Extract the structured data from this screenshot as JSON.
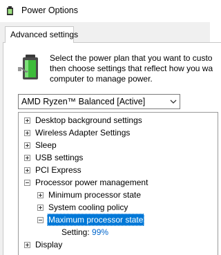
{
  "window": {
    "title": "Power Options"
  },
  "tabs": [
    {
      "label": "Advanced settings"
    }
  ],
  "intro": {
    "lines": [
      "Select the power plan that you want to custo",
      "then choose settings that reflect how you wa",
      "computer to manage power."
    ]
  },
  "plan_select": {
    "selected": "AMD Ryzen™ Balanced [Active]"
  },
  "tree": {
    "items": [
      {
        "label": "Desktop background settings",
        "state": "collapsed"
      },
      {
        "label": "Wireless Adapter Settings",
        "state": "collapsed"
      },
      {
        "label": "Sleep",
        "state": "collapsed"
      },
      {
        "label": "USB settings",
        "state": "collapsed"
      },
      {
        "label": "PCI Express",
        "state": "collapsed"
      },
      {
        "label": "Processor power management",
        "state": "expanded"
      },
      {
        "label": "Minimum processor state",
        "state": "collapsed"
      },
      {
        "label": "System cooling policy",
        "state": "collapsed"
      },
      {
        "label": "Maximum processor state",
        "state": "expanded",
        "selected": true
      },
      {
        "label": "Display",
        "state": "collapsed"
      }
    ],
    "setting": {
      "label": "Setting:",
      "value": "99%"
    }
  },
  "icons": {
    "title": "power-options-icon",
    "plan": "battery-plug-icon",
    "dropdown": "chevron-down-icon"
  },
  "colors": {
    "selection": "#0078d7",
    "setting_value": "#0066cc",
    "battery_green": "#3dbb3a"
  }
}
